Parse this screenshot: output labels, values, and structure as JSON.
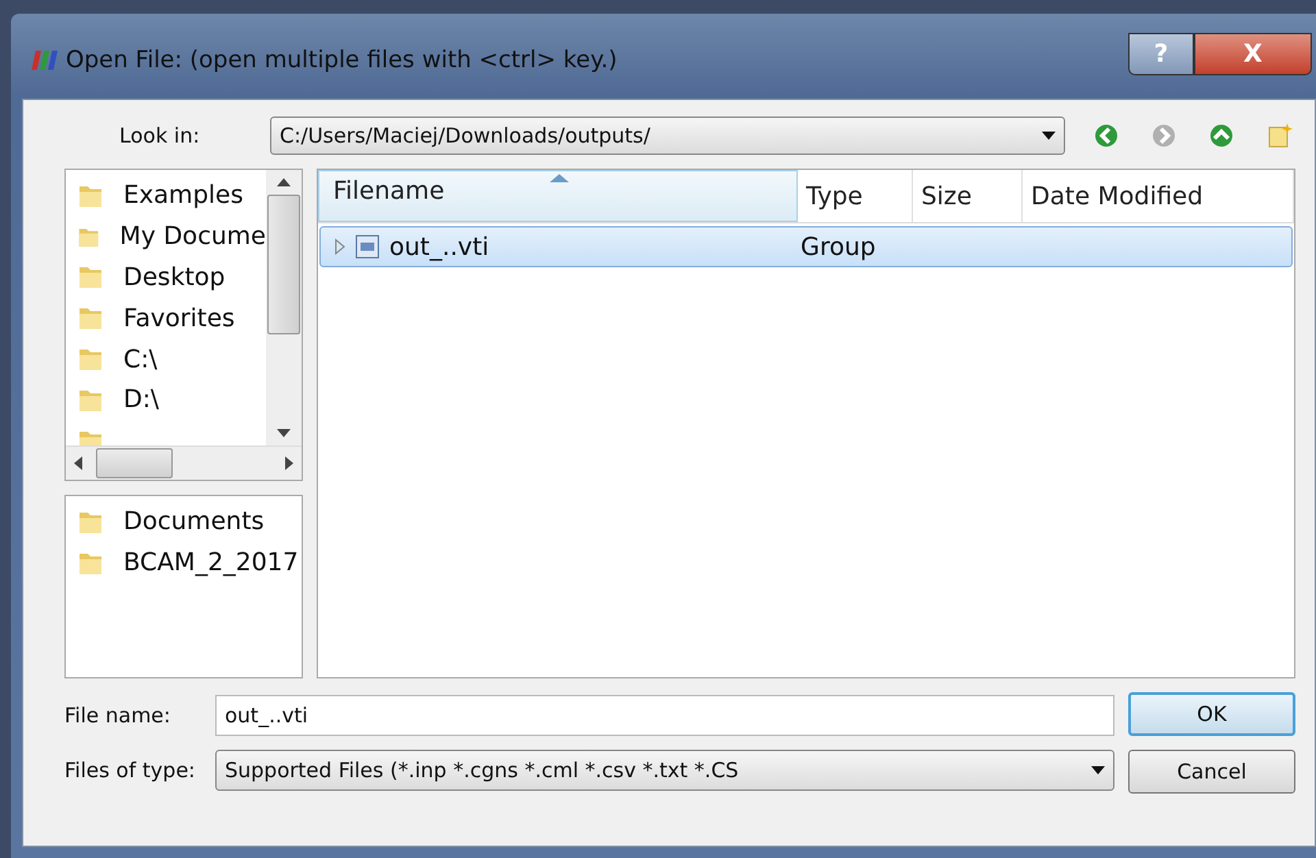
{
  "window": {
    "title": "Open File:  (open multiple files with <ctrl> key.)",
    "help_button": "?",
    "close_button": "X"
  },
  "look_in": {
    "label": "Look in:",
    "value": "C:/Users/Maciej/Downloads/outputs/"
  },
  "nav_buttons": [
    {
      "kind": "back",
      "disabled": false
    },
    {
      "kind": "forward",
      "disabled": true
    },
    {
      "kind": "up",
      "disabled": false
    },
    {
      "kind": "new-folder",
      "disabled": false
    }
  ],
  "places": [
    {
      "label": "Examples"
    },
    {
      "label": "My Docume"
    },
    {
      "label": "Desktop"
    },
    {
      "label": "Favorites"
    },
    {
      "label": "C:\\"
    },
    {
      "label": "D:\\"
    }
  ],
  "recent": [
    {
      "label": "Documents"
    },
    {
      "label": "BCAM_2_2017"
    }
  ],
  "table": {
    "columns": [
      "Filename",
      "Type",
      "Size",
      "Date Modified"
    ],
    "rows": [
      {
        "filename": "out_..vti",
        "type": "Group",
        "selected": true,
        "expanded": false
      }
    ]
  },
  "file_name": {
    "label": "File name:",
    "value": "out_..vti"
  },
  "file_type": {
    "label": "Files of type:",
    "value": "Supported Files (*.inp  *.cgns  *.cml  *.csv *.txt *.CS"
  },
  "buttons": [
    "OK",
    "Cancel"
  ]
}
